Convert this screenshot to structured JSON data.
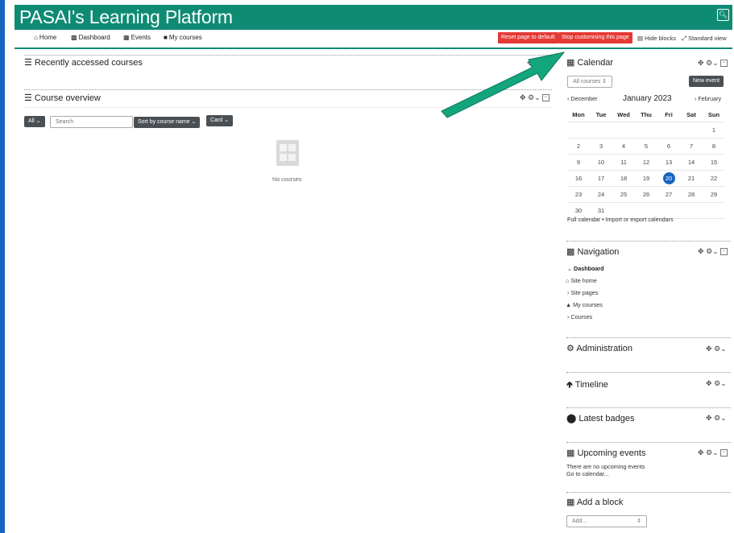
{
  "site": {
    "title": "PASAI's Learning Platform"
  },
  "nav": {
    "home": "Home",
    "dashboard": "Dashboard",
    "events": "Events",
    "my_courses": "My courses",
    "reset": "Reset page to default",
    "stop": "Stop customising this page",
    "hide_blocks": "Hide blocks",
    "standard_view": "Standard view"
  },
  "main": {
    "recent_title": "Recently accessed courses",
    "overview_title": "Course overview",
    "filter_all": "All",
    "search_placeholder": "Search",
    "sort": "Sort by course name",
    "view": "Card",
    "empty": "No courses"
  },
  "calendar": {
    "title": "Calendar",
    "select": "All courses",
    "new_event": "New event",
    "prev": "December",
    "month": "January 2023",
    "next": "February",
    "days": [
      "Mon",
      "Tue",
      "Wed",
      "Thu",
      "Fri",
      "Sat",
      "Sun"
    ],
    "weeks": [
      [
        "",
        "",
        "",
        "",
        "",
        "",
        "1"
      ],
      [
        "2",
        "3",
        "4",
        "5",
        "6",
        "7",
        "8"
      ],
      [
        "9",
        "10",
        "11",
        "12",
        "13",
        "14",
        "15"
      ],
      [
        "16",
        "17",
        "18",
        "19",
        "20",
        "21",
        "22"
      ],
      [
        "23",
        "24",
        "25",
        "26",
        "27",
        "28",
        "29"
      ],
      [
        "30",
        "31",
        "",
        "",
        "",
        "",
        ""
      ]
    ],
    "today": "20",
    "full_link": "Full calendar",
    "sep": " • ",
    "export_link": "Import or export calendars"
  },
  "navigation": {
    "title": "Navigation",
    "items": [
      "Dashboard",
      "Site home",
      "Site pages",
      "My courses",
      "Courses"
    ]
  },
  "administration": {
    "title": "Administration"
  },
  "timeline": {
    "title": "Timeline"
  },
  "badges": {
    "title": "Latest badges"
  },
  "upcoming": {
    "title": "Upcoming events",
    "none": "There are no upcoming events",
    "goto": "Go to calendar..."
  },
  "addblock": {
    "title": "Add a block",
    "select": "Add..."
  },
  "colors": {
    "header": "#0f8b74",
    "red": "#e53935",
    "accent": "#1565c0",
    "arrow": "#13a57c"
  }
}
